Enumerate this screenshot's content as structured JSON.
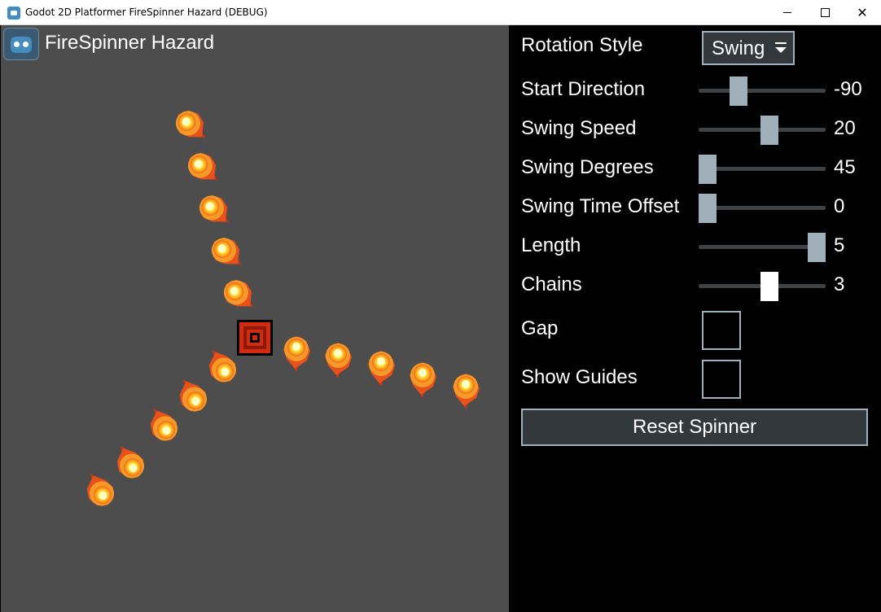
{
  "window": {
    "title": "Godot 2D Platformer FireSpinner Hazard (DEBUG)",
    "controls": [
      "minimize",
      "maximize",
      "close"
    ]
  },
  "viewport": {
    "scene_title": "FireSpinner Hazard",
    "logo_icon": "godot-logo-icon",
    "background": "#4d4d4d"
  },
  "controls": {
    "rotation_style": {
      "label": "Rotation Style",
      "value": "Swing"
    },
    "sliders": [
      {
        "label": "Start Direction",
        "value": "-90",
        "fraction": 0.28
      },
      {
        "label": "Swing Speed",
        "value": "20",
        "fraction": 0.57
      },
      {
        "label": "Swing Degrees",
        "value": "45",
        "fraction": 0.0
      },
      {
        "label": "Swing Time Offset",
        "value": "0",
        "fraction": 0.0
      },
      {
        "label": "Length",
        "value": "5",
        "fraction": 1.0
      },
      {
        "label": "Chains",
        "value": "3",
        "fraction": 0.57,
        "active": true
      }
    ],
    "checkboxes": [
      {
        "label": "Gap",
        "checked": false
      },
      {
        "label": "Show Guides",
        "checked": false
      }
    ],
    "reset_button": "Reset Spinner"
  },
  "colors": {
    "accent": "#9fb0bb",
    "panel_bg": "#000000",
    "button_bg": "#33383d"
  }
}
